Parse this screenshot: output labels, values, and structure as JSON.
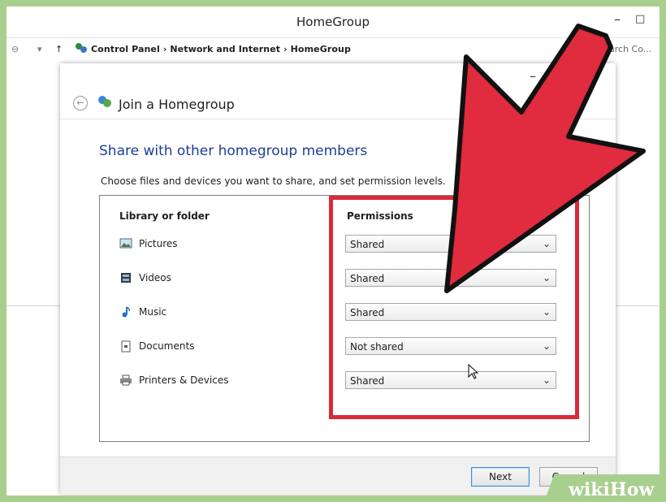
{
  "window": {
    "title": "HomeGroup",
    "minimize": "–",
    "maximize": "□"
  },
  "address": {
    "back": "⊖",
    "dropdown": "▾",
    "up": "↑",
    "crumbs": "Control Panel  ›  Network and Internet  ›  HomeGroup",
    "search_placeholder": "arch Co..."
  },
  "dialog": {
    "minimize": "–",
    "title": "Join a Homegroup",
    "heading": "Share with other homegroup members",
    "instructions": "Choose files and devices you want to share, and set permission levels.",
    "col_library": "Library or folder",
    "col_permissions": "Permissions",
    "rows": [
      {
        "label": "Pictures",
        "icon": "pictures-icon",
        "value": "Shared"
      },
      {
        "label": "Videos",
        "icon": "videos-icon",
        "value": "Shared"
      },
      {
        "label": "Music",
        "icon": "music-icon",
        "value": "Shared"
      },
      {
        "label": "Documents",
        "icon": "documents-icon",
        "value": "Not shared"
      },
      {
        "label": "Printers & Devices",
        "icon": "printer-icon",
        "value": "Shared"
      }
    ],
    "next": "Next",
    "cancel": "Cancel"
  },
  "watermark": {
    "part1": "wiki",
    "part2": "How"
  },
  "colors": {
    "highlight": "#d92a3a",
    "heading": "#1c3f94",
    "frame": "#a9cf8f",
    "arrow_fill": "#e12b3e",
    "arrow_stroke": "#111111"
  }
}
